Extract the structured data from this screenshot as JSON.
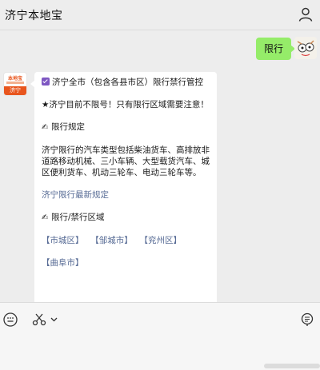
{
  "header": {
    "title": "济宁本地宝"
  },
  "chat": {
    "user_message": "限行",
    "bot": {
      "avatar": {
        "brand_top": "本地宝",
        "brand_bottom": "济宁"
      },
      "title": "济宁全市（包含各县市区）限行禁行管控",
      "notice": "★济宁目前不限号！只有限行区域需要注意！",
      "section1_heading": "限行规定",
      "section1_body": "济宁限行的汽车类型包括柴油货车、高排放非道路移动机械、三小车辆、大型载货汽车、城区便利货车、机动三轮车、电动三轮车等。",
      "latest_link": "济宁限行最新规定",
      "section2_heading": "限行/禁行区域",
      "regions": [
        "【市城区】",
        "【邹城市】",
        "【兖州区】",
        "【曲阜市】"
      ]
    }
  },
  "icons": {
    "header_profile": "person-icon",
    "keyboard": "keyboard-icon",
    "scissors": "scissors-icon",
    "chevron": "chevron-down-icon",
    "menu": "menu-list-icon"
  },
  "colors": {
    "background": "#ededed",
    "user_bubble": "#95ec69",
    "link": "#576b95",
    "brand": "#e8551d"
  }
}
